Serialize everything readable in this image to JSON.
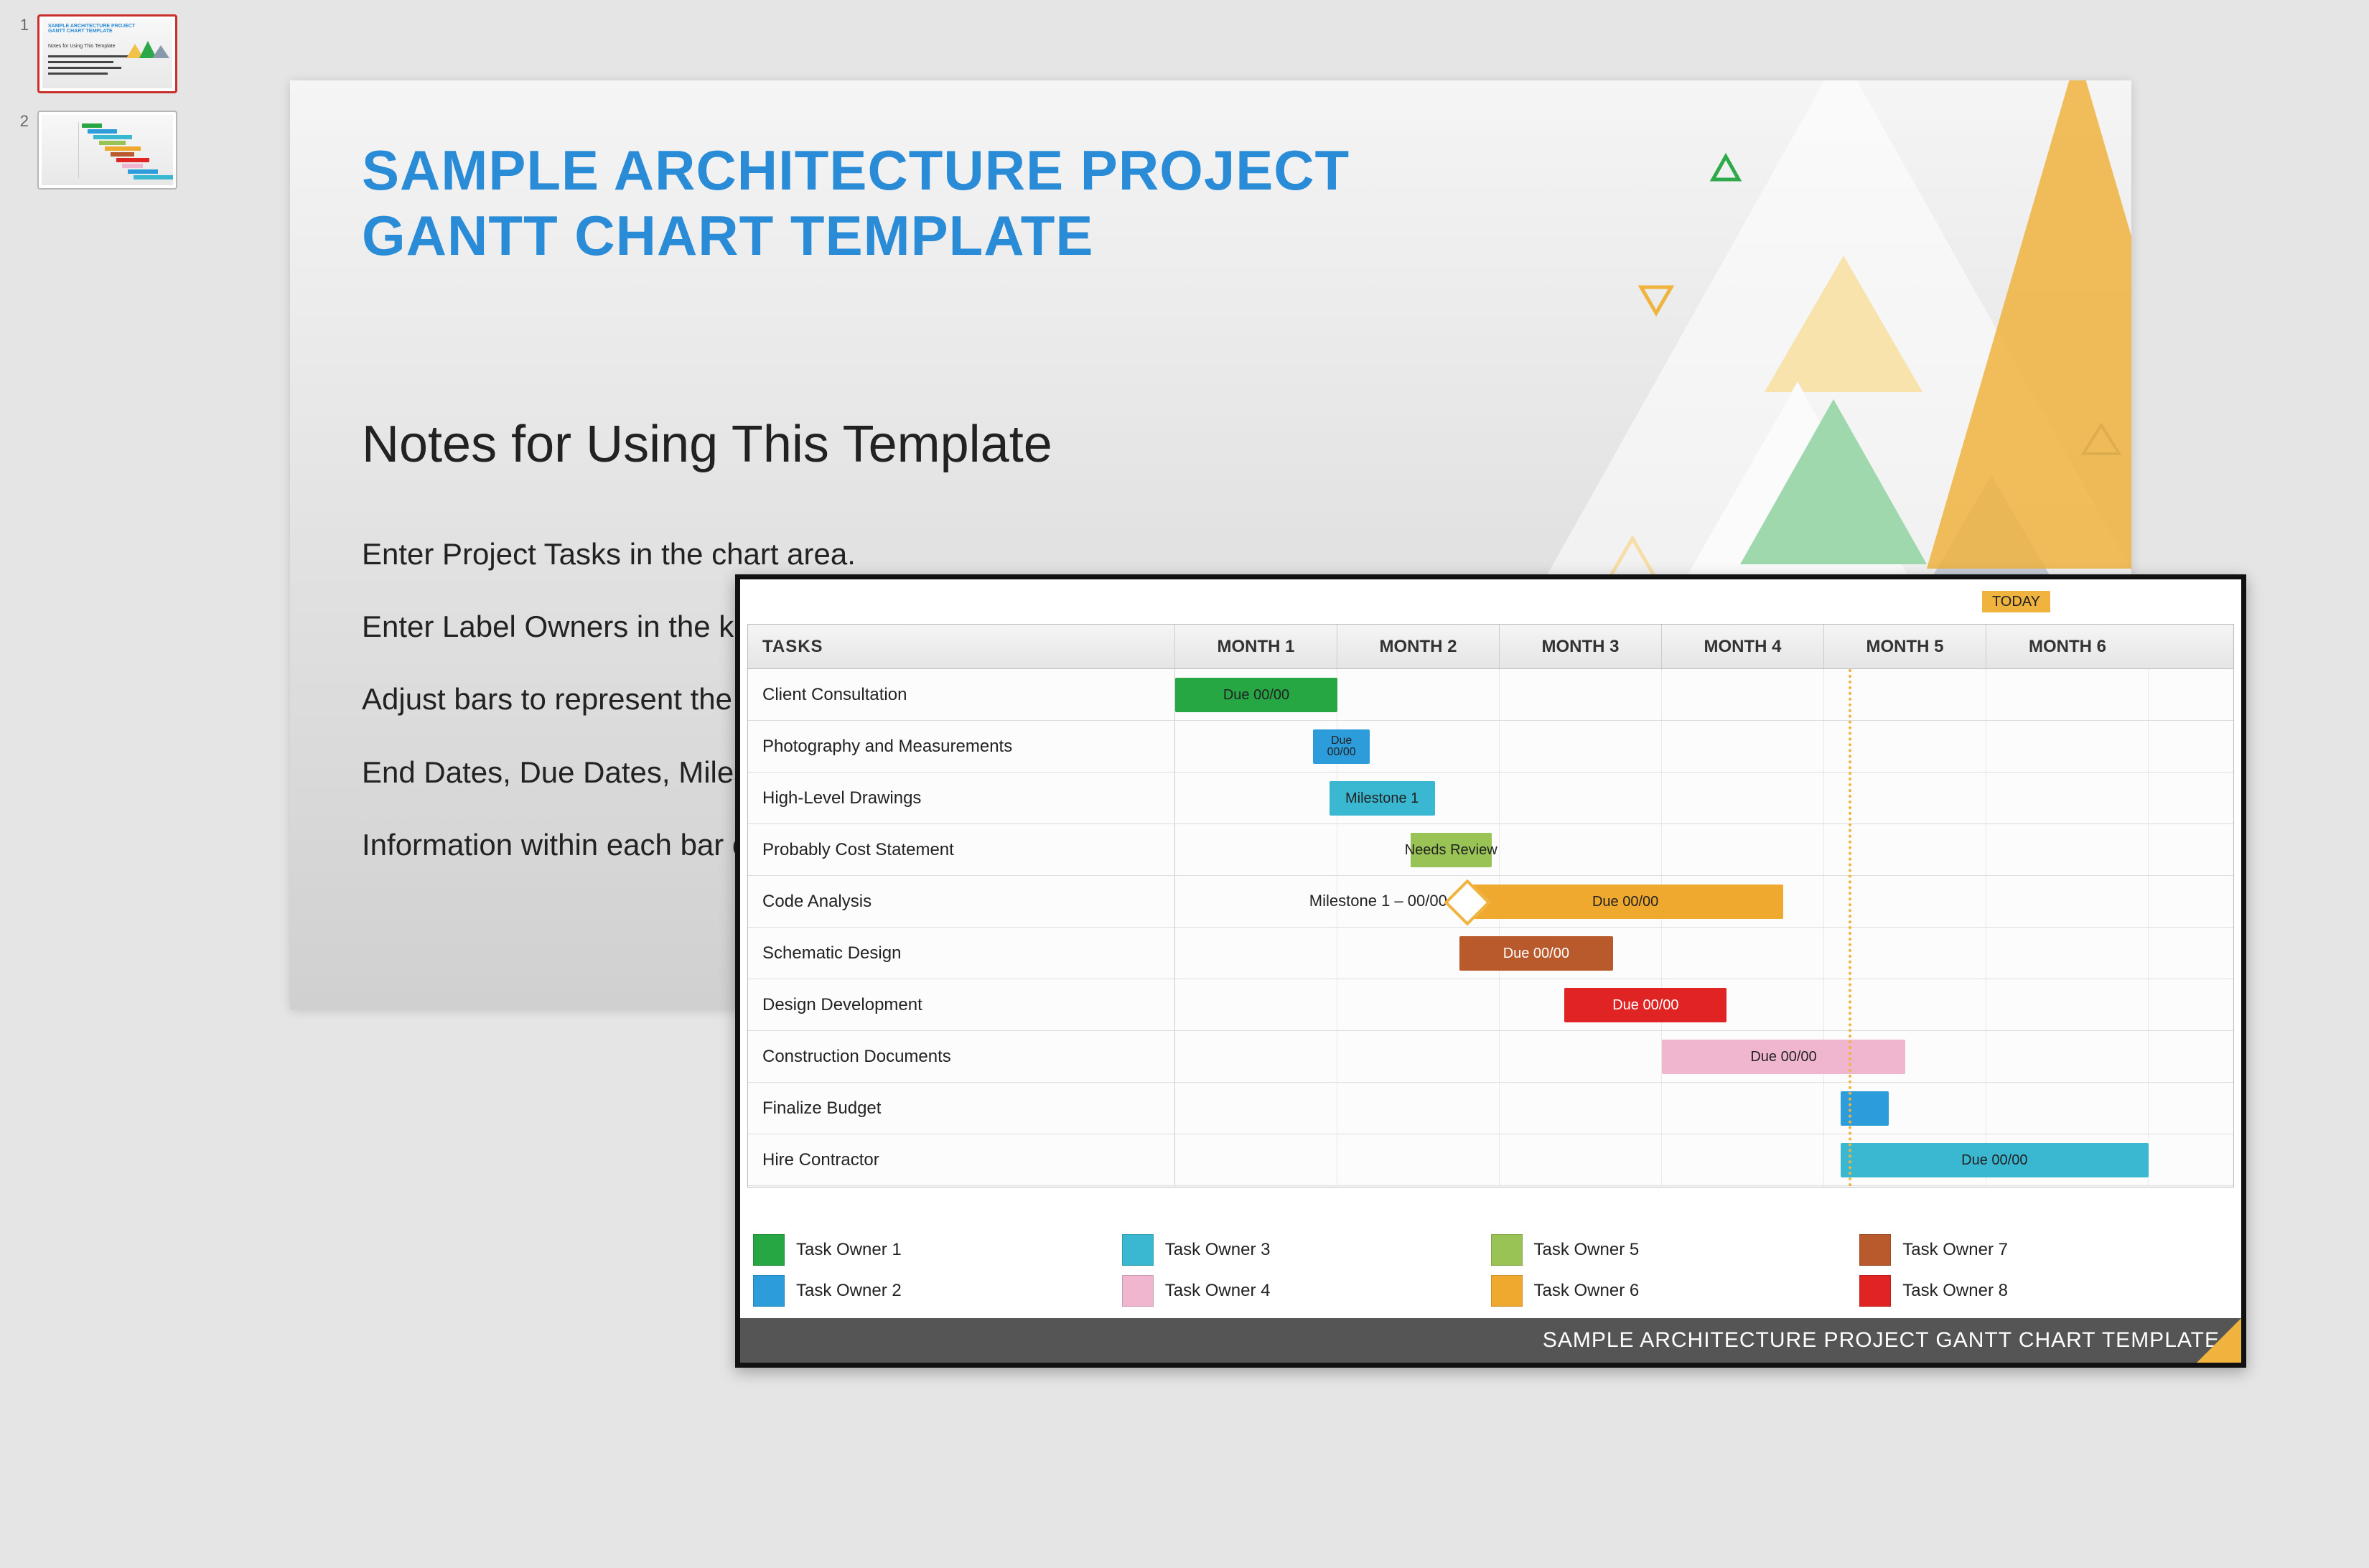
{
  "thumbnails": [
    {
      "number": "1",
      "active": true
    },
    {
      "number": "2",
      "active": false
    }
  ],
  "slide": {
    "title_line1": "SAMPLE ARCHITECTURE PROJECT",
    "title_line2": "GANTT CHART TEMPLATE",
    "subtitle": "Notes for Using This Template",
    "body_lines": [
      "Enter Project Tasks in the chart area.",
      "Enter Label Owners in the key",
      "Adjust bars to represent the le",
      "End Dates, Due Dates, Milesto",
      "Information within each bar or"
    ]
  },
  "gantt": {
    "today_label": "TODAY",
    "tasks_header": "TASKS",
    "months": [
      "MONTH 1",
      "MONTH 2",
      "MONTH 3",
      "MONTH 4",
      "MONTH 5",
      "MONTH 6"
    ],
    "footer": "SAMPLE ARCHITECTURE PROJECT GANTT CHART TEMPLATE"
  },
  "legend": [
    {
      "label": "Task Owner 1",
      "color": "#27a644"
    },
    {
      "label": "Task Owner 3",
      "color": "#3bb8d1"
    },
    {
      "label": "Task Owner 5",
      "color": "#99c455"
    },
    {
      "label": "Task Owner 7",
      "color": "#b85a2b"
    },
    {
      "label": "Task Owner 2",
      "color": "#2d9cdb"
    },
    {
      "label": "Task Owner 4",
      "color": "#f1b6cf"
    },
    {
      "label": "Task Owner 6",
      "color": "#efa92e"
    },
    {
      "label": "Task Owner 8",
      "color": "#e02424"
    }
  ],
  "chart_data": {
    "type": "bar",
    "orientation": "horizontal-gantt",
    "x_unit": "months",
    "xlim": [
      0,
      6
    ],
    "categories": [
      "Client Consultation",
      "Photography and Measurements",
      "High-Level Drawings",
      "Probably Cost Statement",
      "Code Analysis",
      "Schematic Design",
      "Design Development",
      "Construction Documents",
      "Finalize Budget",
      "Hire Contractor"
    ],
    "series": [
      {
        "name": "Client Consultation",
        "owner": "Task Owner 1",
        "color": "#27a644",
        "start": 0.0,
        "end": 1.0,
        "bar_label": "Due 00/00"
      },
      {
        "name": "Photography and Measurements",
        "owner": "Task Owner 2",
        "color": "#2d9cdb",
        "start": 0.85,
        "end": 1.2,
        "bar_label": "Due 00/00"
      },
      {
        "name": "High-Level Drawings",
        "owner": "Task Owner 3",
        "color": "#3bb8d1",
        "start": 0.95,
        "end": 1.6,
        "bar_label": "Milestone 1"
      },
      {
        "name": "Probably Cost Statement",
        "owner": "Task Owner 5",
        "color": "#99c455",
        "start": 1.45,
        "end": 1.95,
        "bar_label": "Needs Review"
      },
      {
        "name": "Code Analysis",
        "owner": "Task Owner 6",
        "color": "#efa92e",
        "start": 1.8,
        "end": 3.75,
        "bar_label": "Due 00/00",
        "annotation": "Milestone 1 – 00/00",
        "milestone_at": 1.8
      },
      {
        "name": "Schematic Design",
        "owner": "Task Owner 7",
        "color": "#b85a2b",
        "start": 1.75,
        "end": 2.7,
        "bar_label": "Due 00/00"
      },
      {
        "name": "Design Development",
        "owner": "Task Owner 8",
        "color": "#e02424",
        "start": 2.4,
        "end": 3.4,
        "bar_label": "Due 00/00"
      },
      {
        "name": "Construction Documents",
        "owner": "Task Owner 4",
        "color": "#f1b6cf",
        "start": 3.0,
        "end": 4.5,
        "bar_label": "Due 00/00"
      },
      {
        "name": "Finalize Budget",
        "owner": "Task Owner 2",
        "color": "#2d9cdb",
        "start": 4.1,
        "end": 4.4,
        "bar_label": ""
      },
      {
        "name": "Hire Contractor",
        "owner": "Task Owner 3",
        "color": "#3bb8d1",
        "start": 4.1,
        "end": 6.0,
        "bar_label": "Due 00/00"
      }
    ],
    "today_marker": 4.15
  }
}
